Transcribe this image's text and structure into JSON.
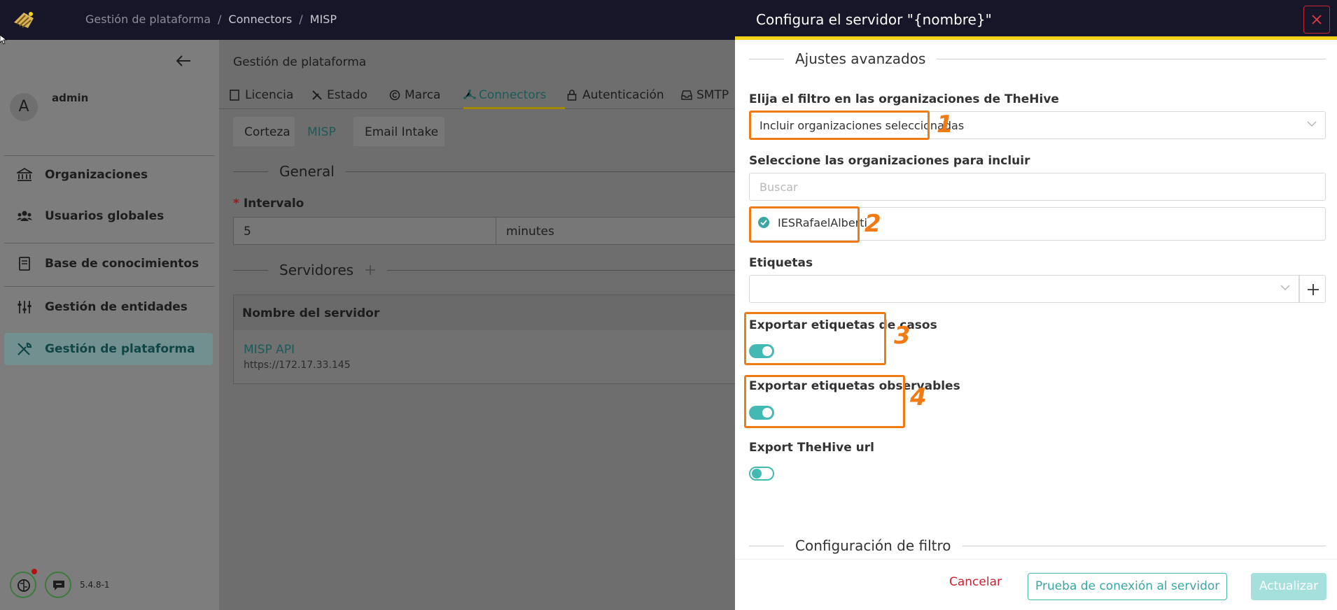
{
  "topbar": {
    "breadcrumb": [
      "Gestión de plataforma",
      "Connectors",
      "MISP"
    ],
    "separator": "/"
  },
  "sidebar": {
    "user_initial": "A",
    "user_name": "admin",
    "items": [
      {
        "label": "Organizaciones",
        "icon": "bank-icon"
      },
      {
        "label": "Usuarios globales",
        "icon": "users-icon"
      },
      {
        "label": "Base de conocimientos",
        "icon": "book-icon"
      },
      {
        "label": "Gestión de entidades",
        "icon": "sliders-icon"
      },
      {
        "label": "Gestión de plataforma",
        "icon": "tools-icon",
        "active": true
      }
    ],
    "version": "5.4.8-1"
  },
  "main": {
    "header": "Gestión de plataforma",
    "tabs": [
      {
        "label": "Licencia",
        "icon": "license-icon"
      },
      {
        "label": "Estado",
        "icon": "wrench-icon"
      },
      {
        "label": "Marca",
        "icon": "copyright-icon"
      },
      {
        "label": "Connectors",
        "icon": "connectors-icon",
        "active": true
      },
      {
        "label": "Autenticación",
        "icon": "lock-icon"
      },
      {
        "label": "SMTP",
        "icon": "inbox-icon"
      }
    ],
    "subtabs": [
      "Corteza",
      "MISP",
      "Email Intake"
    ],
    "general_title": "General",
    "interval_label": "Intervalo",
    "interval_required_mark": "*",
    "interval_value": "5",
    "interval_unit": "minutes",
    "servers_title": "Servidores",
    "table_header": "Nombre del servidor",
    "server_name": "MISP API",
    "server_url": "https://172.17.33.145"
  },
  "drawer": {
    "title": "Configura el servidor \"{nombre}\"",
    "advanced_section": "Ajustes avanzados",
    "filter_label": "Elija el filtro en las organizaciones de TheHive",
    "filter_value": "Incluir organizaciones seleccionadas",
    "orgs_label": "Seleccione las organizaciones para incluir",
    "search_placeholder": "Buscar",
    "selected_org": "IESRafaelAlberti",
    "tags_label": "Etiquetas",
    "export_case_tags_label": "Exportar etiquetas de casos",
    "export_case_tags": true,
    "export_observable_tags_label": "Exportar etiquetas observables",
    "export_observable_tags": true,
    "export_url_label": "Export TheHive url",
    "export_url": false,
    "filter_section": "Configuración de filtro",
    "annotations": [
      "1",
      "2",
      "3",
      "4"
    ]
  },
  "footer": {
    "cancel": "Cancelar",
    "test": "Prueba de conexión al servidor",
    "update": "Actualizar"
  },
  "colors": {
    "accent": "#44b9b4",
    "annotation": "#f07a14",
    "header_bg": "#161628",
    "header_stripe": "#f2d21a",
    "danger": "#c82333"
  }
}
